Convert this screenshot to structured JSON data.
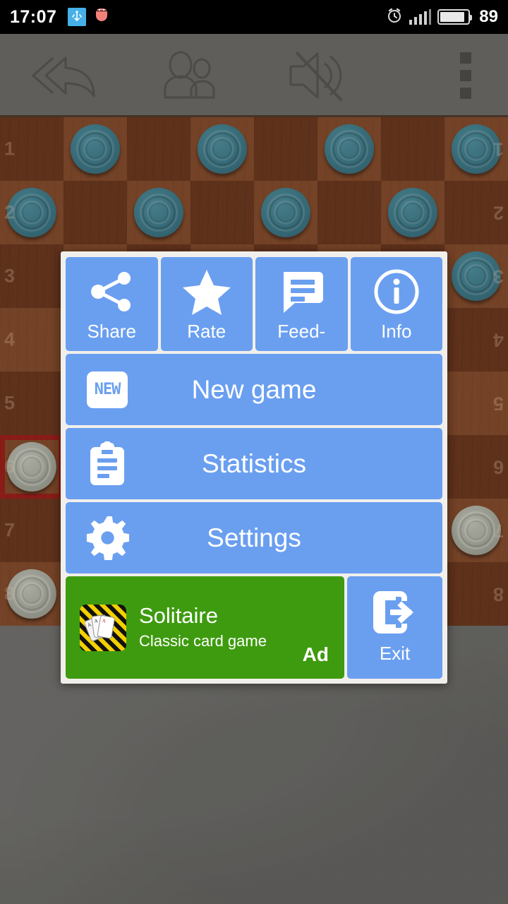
{
  "status_bar": {
    "time": "17:07",
    "battery_level": "89",
    "icons": [
      "usb-icon",
      "bug-icon",
      "alarm-clock-icon",
      "signal-icon",
      "battery-icon"
    ]
  },
  "game_toolbar": {
    "buttons": [
      {
        "name": "undo-move-button",
        "icon": "double-back-arrow-icon"
      },
      {
        "name": "players-button",
        "icon": "two-people-icon"
      },
      {
        "name": "mute-sound-button",
        "icon": "speaker-muted-icon"
      },
      {
        "name": "overflow-menu-button",
        "icon": "three-dots-vertical-icon"
      }
    ]
  },
  "board": {
    "rows": 8,
    "columns": 8,
    "row_labels_left": [
      "1",
      "2",
      "3",
      "4",
      "5",
      "6",
      "7",
      "8"
    ],
    "row_labels_right": [
      "1",
      "2",
      "3",
      "4",
      "5",
      "6",
      "7",
      "8"
    ],
    "dark_square_color": "#6d3418",
    "light_square_color": "#8a4a26",
    "teal_piece_color": "#3d7f90",
    "light_piece_color": "#b3b6a7",
    "highlight_color": "#a81010",
    "pieces": [
      {
        "row": 0,
        "col": 1,
        "side": "teal"
      },
      {
        "row": 0,
        "col": 3,
        "side": "teal"
      },
      {
        "row": 0,
        "col": 5,
        "side": "teal"
      },
      {
        "row": 0,
        "col": 7,
        "side": "teal"
      },
      {
        "row": 1,
        "col": 0,
        "side": "teal"
      },
      {
        "row": 1,
        "col": 2,
        "side": "teal"
      },
      {
        "row": 1,
        "col": 4,
        "side": "teal"
      },
      {
        "row": 1,
        "col": 6,
        "side": "teal"
      },
      {
        "row": 2,
        "col": 7,
        "side": "teal"
      },
      {
        "row": 5,
        "col": 0,
        "side": "light",
        "highlight": true
      },
      {
        "row": 6,
        "col": 7,
        "side": "light"
      },
      {
        "row": 7,
        "col": 0,
        "side": "light"
      }
    ]
  },
  "menu_dialog": {
    "accent_color": "#6a9ff0",
    "background_color": "#f1efeb",
    "quick_actions": [
      {
        "label": "Share",
        "icon": "share-icon",
        "name": "share-button"
      },
      {
        "label": "Rate",
        "icon": "star-icon",
        "name": "rate-button"
      },
      {
        "label": "Feed-",
        "icon": "feedback-chat-icon",
        "name": "feedback-button"
      },
      {
        "label": "Info",
        "icon": "info-circle-icon",
        "name": "info-button"
      }
    ],
    "main_actions": [
      {
        "label": "New game",
        "icon": "new-badge-icon",
        "badge_text": "NEW",
        "name": "new-game-button"
      },
      {
        "label": "Statistics",
        "icon": "clipboard-icon",
        "name": "statistics-button"
      },
      {
        "label": "Settings",
        "icon": "gear-icon",
        "name": "settings-button"
      }
    ],
    "ad": {
      "title": "Solitaire",
      "subtitle": "Classic card game",
      "label": "Ad",
      "icon": "playing-cards-icon",
      "background_color": "#3e9b0f"
    },
    "exit": {
      "label": "Exit",
      "icon": "exit-arrow-icon"
    }
  }
}
